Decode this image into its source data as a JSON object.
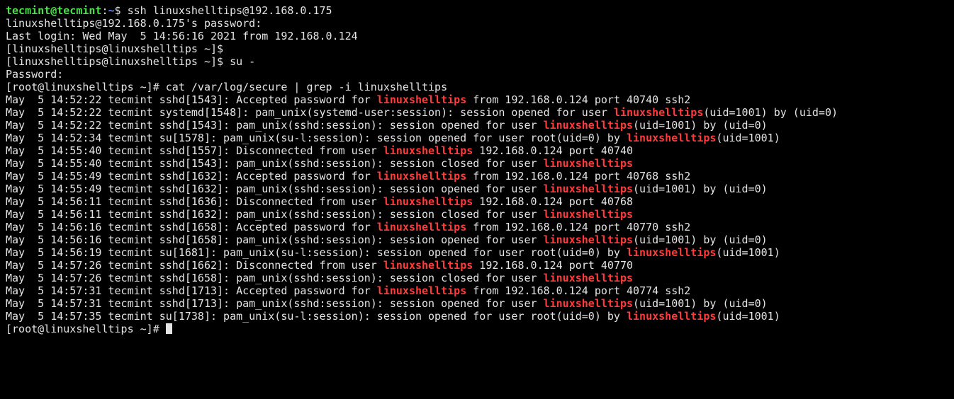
{
  "prompt_tecmint_user": "tecmint@tecmint",
  "prompt_tecmint_sep": ":",
  "prompt_tecmint_path": "~",
  "prompt_tecmint_cmd": "$ ssh linuxshelltips@192.168.0.175",
  "pw_prompt_1": "linuxshelltips@192.168.0.175's password:",
  "last_login": "Last login: Wed May  5 14:56:16 2021 from 192.168.0.124",
  "prompt_lst_1": "[linuxshelltips@linuxshelltips ~]$",
  "prompt_lst_2": "[linuxshelltips@linuxshelltips ~]$ su -",
  "pw_prompt_2": "Password:",
  "prompt_root_cmd": "[root@linuxshelltips ~]# cat /var/log/secure | grep -i linuxshelltips",
  "kw": "linuxshelltips",
  "log": [
    {
      "pre": "May  5 14:52:22 tecmint sshd[1543]: Accepted password for ",
      "hi": "linuxshelltips",
      "post": " from 192.168.0.124 port 40740 ssh2"
    },
    {
      "pre": "May  5 14:52:22 tecmint systemd[1548]: pam_unix(systemd-user:session): session opened for user ",
      "hi": "linuxshelltips",
      "post": "(uid=1001) by (uid=0)"
    },
    {
      "pre": "May  5 14:52:22 tecmint sshd[1543]: pam_unix(sshd:session): session opened for user ",
      "hi": "linuxshelltips",
      "post": "(uid=1001) by (uid=0)"
    },
    {
      "pre": "May  5 14:52:34 tecmint su[1578]: pam_unix(su-l:session): session opened for user root(uid=0) by ",
      "hi": "linuxshelltips",
      "post": "(uid=1001)"
    },
    {
      "pre": "May  5 14:55:40 tecmint sshd[1557]: Disconnected from user ",
      "hi": "linuxshelltips",
      "post": " 192.168.0.124 port 40740"
    },
    {
      "pre": "May  5 14:55:40 tecmint sshd[1543]: pam_unix(sshd:session): session closed for user ",
      "hi": "linuxshelltips",
      "post": ""
    },
    {
      "pre": "May  5 14:55:49 tecmint sshd[1632]: Accepted password for ",
      "hi": "linuxshelltips",
      "post": " from 192.168.0.124 port 40768 ssh2"
    },
    {
      "pre": "May  5 14:55:49 tecmint sshd[1632]: pam_unix(sshd:session): session opened for user ",
      "hi": "linuxshelltips",
      "post": "(uid=1001) by (uid=0)"
    },
    {
      "pre": "May  5 14:56:11 tecmint sshd[1636]: Disconnected from user ",
      "hi": "linuxshelltips",
      "post": " 192.168.0.124 port 40768"
    },
    {
      "pre": "May  5 14:56:11 tecmint sshd[1632]: pam_unix(sshd:session): session closed for user ",
      "hi": "linuxshelltips",
      "post": ""
    },
    {
      "pre": "May  5 14:56:16 tecmint sshd[1658]: Accepted password for ",
      "hi": "linuxshelltips",
      "post": " from 192.168.0.124 port 40770 ssh2"
    },
    {
      "pre": "May  5 14:56:16 tecmint sshd[1658]: pam_unix(sshd:session): session opened for user ",
      "hi": "linuxshelltips",
      "post": "(uid=1001) by (uid=0)"
    },
    {
      "pre": "May  5 14:56:19 tecmint su[1681]: pam_unix(su-l:session): session opened for user root(uid=0) by ",
      "hi": "linuxshelltips",
      "post": "(uid=1001)"
    },
    {
      "pre": "May  5 14:57:26 tecmint sshd[1662]: Disconnected from user ",
      "hi": "linuxshelltips",
      "post": " 192.168.0.124 port 40770"
    },
    {
      "pre": "May  5 14:57:26 tecmint sshd[1658]: pam_unix(sshd:session): session closed for user ",
      "hi": "linuxshelltips",
      "post": ""
    },
    {
      "pre": "May  5 14:57:31 tecmint sshd[1713]: Accepted password for ",
      "hi": "linuxshelltips",
      "post": " from 192.168.0.124 port 40774 ssh2"
    },
    {
      "pre": "May  5 14:57:31 tecmint sshd[1713]: pam_unix(sshd:session): session opened for user ",
      "hi": "linuxshelltips",
      "post": "(uid=1001) by (uid=0)"
    },
    {
      "pre": "May  5 14:57:35 tecmint su[1738]: pam_unix(su-l:session): session opened for user root(uid=0) by ",
      "hi": "linuxshelltips",
      "post": "(uid=1001)"
    }
  ],
  "prompt_root_idle": "[root@linuxshelltips ~]# "
}
